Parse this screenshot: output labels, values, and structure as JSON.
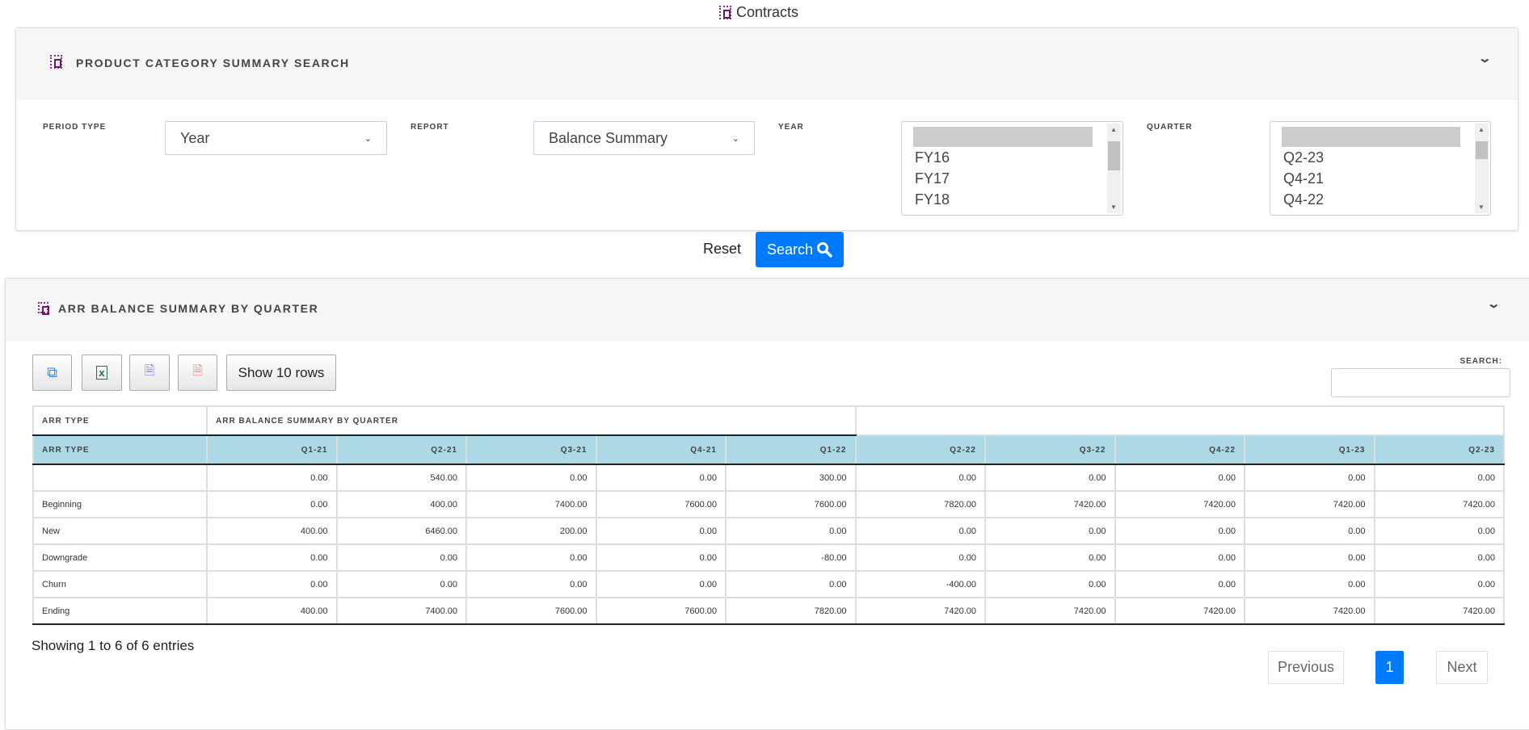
{
  "page": {
    "title": "Contracts",
    "icon": "product-icon"
  },
  "search_panel": {
    "title": "PRODUCT CATEGORY SUMMARY SEARCH",
    "period_type": {
      "label": "PERIOD TYPE",
      "value": "Year"
    },
    "report": {
      "label": "REPORT",
      "value": "Balance Summary"
    },
    "year": {
      "label": "YEAR",
      "options": [
        "",
        "FY16",
        "FY17",
        "FY18"
      ]
    },
    "quarter": {
      "label": "QUARTER",
      "options": [
        "",
        "Q2-23",
        "Q4-21",
        "Q4-22"
      ]
    },
    "reset_label": "Reset",
    "search_label": "Search"
  },
  "results_panel": {
    "title": "ARR BALANCE SUMMARY BY QUARTER",
    "toolbar": {
      "copy": "copy-icon",
      "excel": "excel-icon",
      "csv": "csv-icon",
      "pdf": "pdf-icon",
      "show_rows": "Show 10 rows"
    },
    "search_label": "SEARCH:",
    "search_value": "",
    "table": {
      "group_headers": [
        "ARR TYPE",
        "ARR BALANCE SUMMARY BY QUARTER",
        ""
      ],
      "columns": [
        "ARR TYPE",
        "Q1-21",
        "Q2-21",
        "Q3-21",
        "Q4-21",
        "Q1-22",
        "Q2-22",
        "Q3-22",
        "Q4-22",
        "Q1-23",
        "Q2-23"
      ],
      "rows": [
        [
          "",
          "0.00",
          "540.00",
          "0.00",
          "0.00",
          "300.00",
          "0.00",
          "0.00",
          "0.00",
          "0.00",
          "0.00"
        ],
        [
          "Beginning",
          "0.00",
          "400.00",
          "7400.00",
          "7600.00",
          "7600.00",
          "7820.00",
          "7420.00",
          "7420.00",
          "7420.00",
          "7420.00"
        ],
        [
          "New",
          "400.00",
          "6460.00",
          "200.00",
          "0.00",
          "0.00",
          "0.00",
          "0.00",
          "0.00",
          "0.00",
          "0.00"
        ],
        [
          "Downgrade",
          "0.00",
          "0.00",
          "0.00",
          "0.00",
          "-80.00",
          "0.00",
          "0.00",
          "0.00",
          "0.00",
          "0.00"
        ],
        [
          "Churn",
          "0.00",
          "0.00",
          "0.00",
          "0.00",
          "0.00",
          "-400.00",
          "0.00",
          "0.00",
          "0.00",
          "0.00"
        ],
        [
          "Ending",
          "400.00",
          "7400.00",
          "7600.00",
          "7600.00",
          "7820.00",
          "7420.00",
          "7420.00",
          "7420.00",
          "7420.00",
          "7420.00"
        ]
      ]
    },
    "info": "Showing 1 to 6 of 6 entries",
    "pagination": {
      "previous": "Previous",
      "current": "1",
      "next": "Next"
    }
  },
  "colors": {
    "primary": "#007bff",
    "header_row": "#add8e6",
    "icon": "#8a2a8a"
  }
}
